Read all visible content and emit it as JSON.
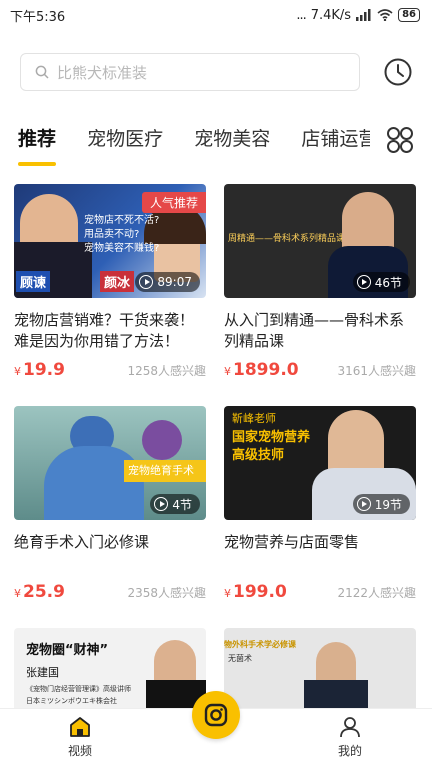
{
  "status_bar": {
    "time": "下午5:36",
    "signal_dots": "...",
    "speed": "7.4K/s",
    "battery": "86"
  },
  "search": {
    "placeholder": "比熊犬标准装"
  },
  "tabs": [
    {
      "label": "推荐",
      "active": true
    },
    {
      "label": "宠物医疗",
      "active": false
    },
    {
      "label": "宠物美容",
      "active": false
    },
    {
      "label": "店铺运营",
      "active": false
    }
  ],
  "courses": [
    {
      "title": "宠物店营销难？干货来袭！难是因为你用错了方法！",
      "price": "19.9",
      "currency": "¥",
      "interest": "1258人感兴趣",
      "badge": "89:07",
      "thumb": {
        "tag": "人气推荐",
        "lines": [
          "宠物店不死不活?",
          "用品卖不动?",
          "宠物美容不赚钱?"
        ],
        "name_left": "顾谏",
        "name_right": "颜冰"
      }
    },
    {
      "title": "从入门到精通——骨科术系列精品课",
      "price": "1899.0",
      "currency": "¥",
      "interest": "3161人感兴趣",
      "badge": "46节",
      "thumb": {
        "banner": "周精通——骨科术系列精品课"
      }
    },
    {
      "title": "绝育手术入门必修课",
      "price": "25.9",
      "currency": "¥",
      "interest": "2358人感兴趣",
      "badge": "4节",
      "thumb": {
        "tag": "宠物绝育手术"
      }
    },
    {
      "title": "宠物营养与店面零售",
      "price": "199.0",
      "currency": "¥",
      "interest": "2122人感兴趣",
      "badge": "19节",
      "thumb": {
        "teacher": "靳峰老师",
        "line1": "国家宠物营养",
        "line2": "高级技师"
      }
    },
    {
      "thumb": {
        "heading": "宠物圈“财神”",
        "name": "张建国",
        "line1": "《宠物门店经营管理课》高级讲师",
        "line2": "日本ミツシンボウエキ株会社"
      }
    },
    {
      "thumb": {
        "banner": "物外科手术学必修课",
        "sub": "无菌术"
      }
    }
  ],
  "bottom_nav": {
    "video_label": "视频",
    "mine_label": "我的"
  },
  "colors": {
    "accent": "#f9c000",
    "price": "#f0493e"
  }
}
